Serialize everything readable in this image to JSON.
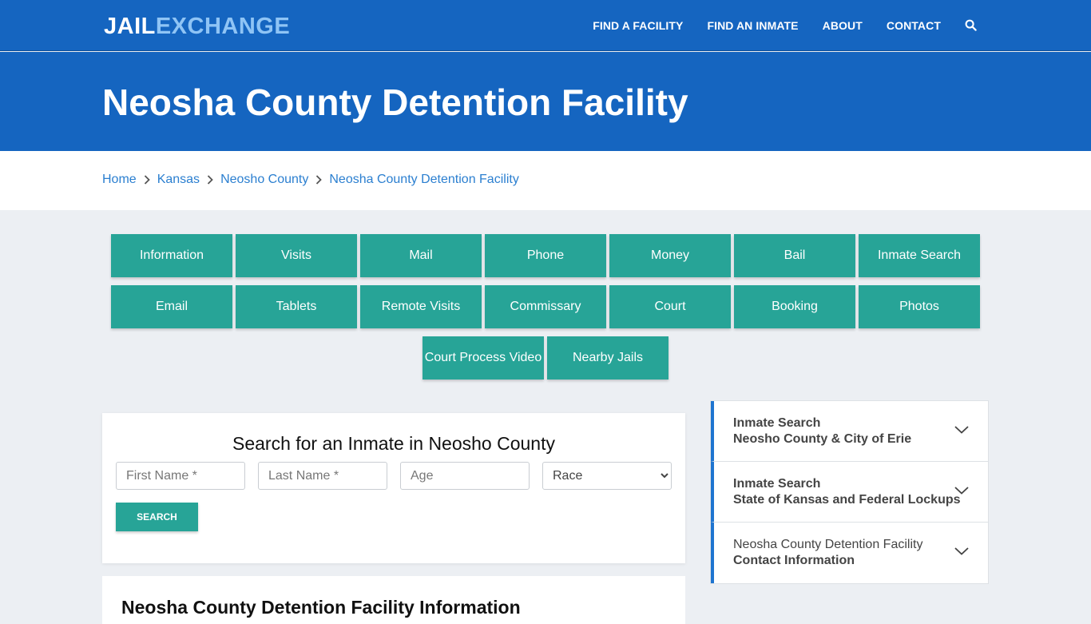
{
  "logo": {
    "part1": "JAIL",
    "part2": "EXCHANGE"
  },
  "nav": {
    "items": [
      "FIND A FACILITY",
      "FIND AN INMATE",
      "ABOUT",
      "CONTACT"
    ]
  },
  "hero": {
    "title": "Neosha County Detention Facility"
  },
  "breadcrumb": [
    "Home",
    "Kansas",
    "Neosho County",
    "Neosha County Detention Facility"
  ],
  "tiles": {
    "row1": [
      "Information",
      "Visits",
      "Mail",
      "Phone",
      "Money",
      "Bail",
      "Inmate Search"
    ],
    "row2": [
      "Email",
      "Tablets",
      "Remote Visits",
      "Commissary",
      "Court",
      "Booking",
      "Photos"
    ],
    "row3": [
      "Court Process Video",
      "Nearby Jails"
    ]
  },
  "search": {
    "title": "Search for an Inmate in Neosho County",
    "first_name_placeholder": "First Name *",
    "last_name_placeholder": "Last Name *",
    "age_placeholder": "Age",
    "race_selected": "Race",
    "button": "SEARCH"
  },
  "info": {
    "title": "Neosha County Detention Facility Information"
  },
  "accordion": [
    {
      "line1": "Inmate Search",
      "line2": "Neosho County & City of Erie"
    },
    {
      "line1": "Inmate Search",
      "line2": "State of Kansas and Federal Lockups"
    },
    {
      "line1": "Neosha County Detention Facility",
      "line2": "Contact Information"
    }
  ],
  "colors": {
    "brand_blue": "#1565c0",
    "teal": "#27a497",
    "link_blue": "#2b7fd0"
  }
}
